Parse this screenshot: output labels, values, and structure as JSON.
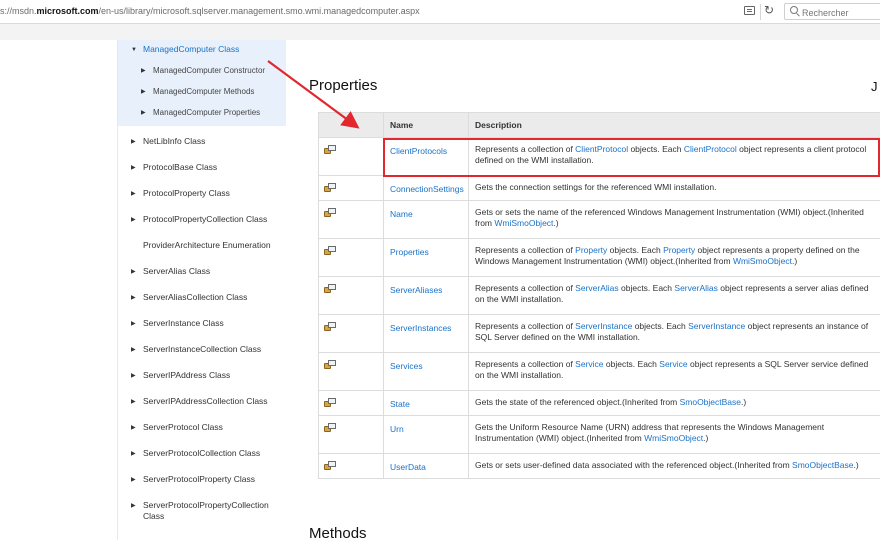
{
  "browser": {
    "url_prefix": "s://msdn.",
    "url_domain": "microsoft.com",
    "url_path": "/en-us/library/microsoft.sqlserver.management.smo.wmi.managedcomputer.aspx",
    "search_placeholder": "Rechercher"
  },
  "sidebar": {
    "selected": {
      "label": "ManagedComputer Class"
    },
    "children": [
      {
        "label": "ManagedComputer Constructor"
      },
      {
        "label": "ManagedComputer Methods"
      },
      {
        "label": "ManagedComputer Properties"
      }
    ],
    "items": [
      {
        "label": "NetLibInfo Class",
        "arrow": true
      },
      {
        "label": "ProtocolBase Class",
        "arrow": true
      },
      {
        "label": "ProtocolProperty Class",
        "arrow": true
      },
      {
        "label": "ProtocolPropertyCollection Class",
        "arrow": true
      },
      {
        "label": "ProviderArchitecture Enumeration",
        "arrow": false
      },
      {
        "label": "ServerAlias Class",
        "arrow": true
      },
      {
        "label": "ServerAliasCollection Class",
        "arrow": true
      },
      {
        "label": "ServerInstance Class",
        "arrow": true
      },
      {
        "label": "ServerInstanceCollection Class",
        "arrow": true
      },
      {
        "label": "ServerIPAddress Class",
        "arrow": true
      },
      {
        "label": "ServerIPAddressCollection Class",
        "arrow": true
      },
      {
        "label": "ServerProtocol Class",
        "arrow": true
      },
      {
        "label": "ServerProtocolCollection Class",
        "arrow": true
      },
      {
        "label": "ServerProtocolProperty Class",
        "arrow": true
      },
      {
        "label": "ServerProtocolPropertyCollection Class",
        "arrow": true
      }
    ]
  },
  "content": {
    "properties_heading": "Properties",
    "edge_glyph": "J",
    "methods_heading": "Methods",
    "table": {
      "col_name": "Name",
      "col_desc": "Description",
      "rows": [
        {
          "name": "ClientProtocols",
          "desc": [
            {
              "t": "Represents a collection of "
            },
            {
              "t": "ClientProtocol",
              "link": true
            },
            {
              "t": " objects. Each "
            },
            {
              "t": "ClientProtocol",
              "link": true
            },
            {
              "t": " object represents a client protocol defined on the WMI installation."
            }
          ]
        },
        {
          "name": "ConnectionSettings",
          "desc": [
            {
              "t": "Gets the connection settings for the referenced WMI installation."
            }
          ]
        },
        {
          "name": "Name",
          "desc": [
            {
              "t": "Gets or sets the name of the referenced Windows Management Instrumentation (WMI) object.(Inherited from "
            },
            {
              "t": "WmiSmoObject",
              "link": true
            },
            {
              "t": ".)"
            }
          ]
        },
        {
          "name": "Properties",
          "desc": [
            {
              "t": "Represents a collection of "
            },
            {
              "t": "Property",
              "link": true
            },
            {
              "t": " objects. Each "
            },
            {
              "t": "Property",
              "link": true
            },
            {
              "t": " object represents a property defined on the Windows Management Instrumentation (WMI) object.(Inherited from "
            },
            {
              "t": "WmiSmoObject",
              "link": true
            },
            {
              "t": ".)"
            }
          ]
        },
        {
          "name": "ServerAliases",
          "desc": [
            {
              "t": "Represents a collection of "
            },
            {
              "t": "ServerAlias",
              "link": true
            },
            {
              "t": " objects. Each "
            },
            {
              "t": "ServerAlias",
              "link": true
            },
            {
              "t": " object represents a server alias defined on the WMI installation."
            }
          ]
        },
        {
          "name": "ServerInstances",
          "desc": [
            {
              "t": "Represents a collection of "
            },
            {
              "t": "ServerInstance",
              "link": true
            },
            {
              "t": " objects. Each "
            },
            {
              "t": "ServerInstance",
              "link": true
            },
            {
              "t": " object represents an instance of SQL Server defined on the WMI installation."
            }
          ]
        },
        {
          "name": "Services",
          "desc": [
            {
              "t": "Represents a collection of "
            },
            {
              "t": "Service",
              "link": true
            },
            {
              "t": " objects. Each "
            },
            {
              "t": "Service",
              "link": true
            },
            {
              "t": " object represents a SQL Server service defined on the WMI installation."
            }
          ]
        },
        {
          "name": "State",
          "desc": [
            {
              "t": "Gets the state of the referenced object.(Inherited from "
            },
            {
              "t": "SmoObjectBase",
              "link": true
            },
            {
              "t": ".)"
            }
          ]
        },
        {
          "name": "Urn",
          "desc": [
            {
              "t": "Gets the Uniform Resource Name (URN) address that represents the Windows Management Instrumentation (WMI) object.(Inherited from "
            },
            {
              "t": "WmiSmoObject",
              "link": true
            },
            {
              "t": ".)"
            }
          ]
        },
        {
          "name": "UserData",
          "desc": [
            {
              "t": "Gets or sets user-defined data associated with the referenced object.(Inherited from "
            },
            {
              "t": "SmoObjectBase",
              "link": true
            },
            {
              "t": ".)"
            }
          ]
        }
      ]
    }
  },
  "icons": {
    "nav_arrow_expanded": "triangle-down",
    "nav_arrow_collapsed": "triangle-right",
    "property": "property-icon",
    "reload": "reload-icon",
    "reader": "reader-view-icon",
    "search": "search-icon"
  },
  "colors": {
    "link": "#1a72c9",
    "highlight": "#e0282e",
    "selected_bg": "#e8f1fb",
    "header_bg": "#ebebeb"
  }
}
